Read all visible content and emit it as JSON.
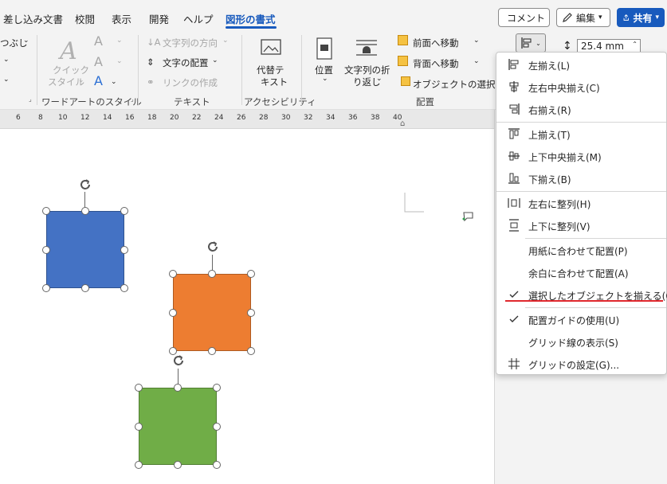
{
  "tabs": [
    "差し込み文書",
    "校閲",
    "表示",
    "開発",
    "ヘルプ",
    "図形の書式"
  ],
  "top_buttons": {
    "comment": "コメント",
    "edit": "編集",
    "share": "共有"
  },
  "ribbon": {
    "shape_fill_partial": "つぶし",
    "quick_style": [
      "クイック",
      "スタイル"
    ],
    "wordart_group": "ワードアートのスタイル",
    "text_direction": "文字列の方向",
    "text_align": "文字の配置",
    "create_link": "リンクの作成",
    "text_group": "テキスト",
    "alt_text": [
      "代替テ",
      "キスト"
    ],
    "accessibility_group": "アクセシビリティ",
    "position": "位置",
    "wrap_text": [
      "文字列の折",
      "り返し"
    ],
    "bring_forward": "前面へ移動",
    "send_backward": "背面へ移動",
    "selection_pane": "オブジェクトの選択と表",
    "arrange_group": "配置",
    "height_value": "25.4 mm"
  },
  "ruler_ticks": [
    "6",
    "8",
    "10",
    "12",
    "14",
    "16",
    "18",
    "20",
    "22",
    "24",
    "26",
    "28",
    "30",
    "32",
    "34",
    "36",
    "38",
    "40"
  ],
  "shapes": {
    "blue": "#4472c4",
    "orange": "#ed7d31",
    "green": "#70ad47"
  },
  "align_menu": {
    "items": [
      {
        "label": "左揃え(L)",
        "icon": "align-left-icon",
        "checked": false
      },
      {
        "label": "左右中央揃え(C)",
        "icon": "align-center-icon",
        "checked": false
      },
      {
        "label": "右揃え(R)",
        "icon": "align-right-icon",
        "checked": false
      },
      {
        "label": "上揃え(T)",
        "icon": "align-top-icon",
        "checked": false
      },
      {
        "label": "上下中央揃え(M)",
        "icon": "align-middle-icon",
        "checked": false
      },
      {
        "label": "下揃え(B)",
        "icon": "align-bottom-icon",
        "checked": false
      },
      {
        "label": "左右に整列(H)",
        "icon": "distribute-horizontal-icon",
        "checked": false
      },
      {
        "label": "上下に整列(V)",
        "icon": "distribute-vertical-icon",
        "checked": false
      },
      {
        "label": "用紙に合わせて配置(P)",
        "icon": "",
        "checked": false
      },
      {
        "label": "余白に合わせて配置(A)",
        "icon": "",
        "checked": false
      },
      {
        "label": "選択したオブジェクトを揃える(O)",
        "icon": "check-icon",
        "checked": true
      },
      {
        "label": "配置ガイドの使用(U)",
        "icon": "check-icon",
        "checked": true
      },
      {
        "label": "グリッド線の表示(S)",
        "icon": "",
        "checked": false
      },
      {
        "label": "グリッドの設定(G)...",
        "icon": "grid-icon",
        "checked": false
      }
    ]
  }
}
